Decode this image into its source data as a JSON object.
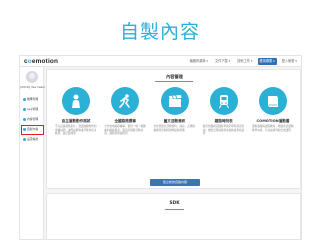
{
  "slide": {
    "title": "自製內容"
  },
  "app": {
    "logo_prefix": "c",
    "logo_accent": "o",
    "logo_suffix": "emotion",
    "nav": [
      {
        "label": "機器資源庫 ▾",
        "primary": false
      },
      {
        "label": "文件下載 ▾",
        "primary": false
      },
      {
        "label": "技術工作 ▾",
        "primary": false
      },
      {
        "label": "應用專業 ▾",
        "primary": true
      },
      {
        "label": "登入帳號 ▾",
        "primary": false
      }
    ]
  },
  "sidebar": {
    "team_name": "[2019] dev team",
    "items": [
      {
        "label": "團隊管理",
        "active": false
      },
      {
        "label": "App管理",
        "active": false
      },
      {
        "label": "內容管理",
        "active": false
      },
      {
        "label": "自製內容",
        "active": true
      },
      {
        "label": "設定帳號",
        "active": false
      }
    ]
  },
  "content": {
    "section_title": "內容管理",
    "cards": [
      {
        "title": "自主運動動作測試",
        "desc": "不只是錄運動影片，透過連續動作的步驟說明，讓學員能夠進行動作自主練習，並記錄成果",
        "icon": "person-silhouette-icon",
        "color": "#2bb0d6"
      },
      {
        "title": "全國路跑賽事",
        "desc": "全台各地路跑賽事，提供一場一場賽事的路線資訊、報名時間與活動內容，讓跑者快速找到",
        "icon": "runner-icon",
        "color": "#2bb0d6"
      },
      {
        "title": "藝文活動資訊",
        "desc": "文化部藝文活動資料，展演、音樂與戲劇等活動時間地點與票價",
        "icon": "film-clapper-icon",
        "color": "#2bb0d6"
      },
      {
        "title": "鐵路時刻表",
        "desc": "提供台鐵與高鐵各車站列車時刻表查詢，依照出發站與到達站快速查找班次",
        "icon": "train-icon",
        "color": "#2bb0d6"
      },
      {
        "title": "COMOTION運動書",
        "desc": "運動書籍與課程教材，收錄各式運動教學內容，可自由排列組合成課程",
        "icon": "book-icon",
        "color": "#2bb0d6"
      }
    ],
    "create_button": "建立新的自製內容"
  },
  "lower": {
    "title": "SDK"
  }
}
